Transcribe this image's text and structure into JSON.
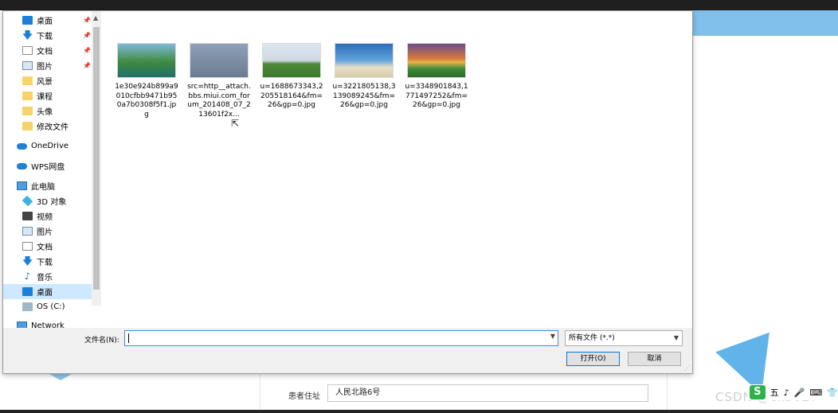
{
  "background_app": {
    "address_label": "患者住址",
    "address_value": "人民北路6号",
    "watermark": "CSDN @ck3027",
    "ime_bar": {
      "logo": "S",
      "mode": "五",
      "items": [
        "♪",
        "🎤",
        "⌨",
        "👕"
      ]
    }
  },
  "nav_pane": {
    "items": [
      {
        "label": "桌面",
        "icon": "desktop-icon",
        "pinned": true
      },
      {
        "label": "下载",
        "icon": "download-arrow-icon",
        "pinned": true
      },
      {
        "label": "文档",
        "icon": "document-icon",
        "pinned": true
      },
      {
        "label": "图片",
        "icon": "picture-icon",
        "pinned": true
      },
      {
        "label": "风景",
        "icon": "folder-icon"
      },
      {
        "label": "课程",
        "icon": "folder-icon"
      },
      {
        "label": "头像",
        "icon": "folder-icon"
      },
      {
        "label": "修改文件",
        "icon": "folder-icon"
      },
      {
        "label": "OneDrive",
        "icon": "cloud-icon"
      },
      {
        "label": "WPS网盘",
        "icon": "cloud-icon"
      },
      {
        "label": "此电脑",
        "icon": "computer-icon"
      },
      {
        "label": "3D 对象",
        "icon": "3d-object-icon"
      },
      {
        "label": "视频",
        "icon": "video-icon"
      },
      {
        "label": "图片",
        "icon": "picture-icon"
      },
      {
        "label": "文档",
        "icon": "document-icon"
      },
      {
        "label": "下载",
        "icon": "download-arrow-icon"
      },
      {
        "label": "音乐",
        "icon": "music-icon"
      },
      {
        "label": "桌面",
        "icon": "desktop-icon",
        "selected": true
      },
      {
        "label": "OS (C:)",
        "icon": "drive-icon"
      },
      {
        "label": "Network",
        "icon": "network-icon"
      }
    ]
  },
  "files": [
    {
      "name": "1e30e924b899a9010cfbb9471b950a7b0308f5f1.jpg",
      "thumb": "waterfall-landscape"
    },
    {
      "name": "src=http__attach.bbs.miui.com_forum_201408_07_213601f2x...",
      "thumb": "person-by-sea"
    },
    {
      "name": "u=1688673343,2205518164&fm=26&gp=0.jpg",
      "thumb": "windmill-field"
    },
    {
      "name": "u=3221805138,3139089245&fm=26&gp=0.jpg",
      "thumb": "beach-sailboat"
    },
    {
      "name": "u=3348901843,1771497252&fm=26&gp=0.jpg",
      "thumb": "sunset-road"
    }
  ],
  "bottom_bar": {
    "filename_label": "文件名(N):",
    "filename_value": "",
    "filetype_selected": "所有文件 (*.*)",
    "open_button": "打开(O)",
    "cancel_button": "取消"
  },
  "colors": {
    "selection": "#cde8ff",
    "accent": "#0078d7",
    "header_blue": "#7fbfe9"
  }
}
